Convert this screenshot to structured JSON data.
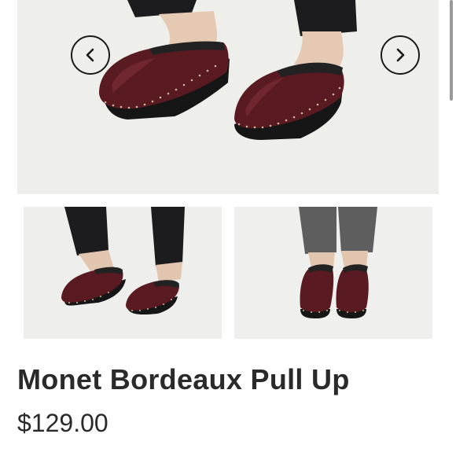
{
  "product": {
    "title": "Monet Bordeaux Pull Up",
    "price": "$129.00"
  },
  "gallery": {
    "prev_icon": "chevron-left-icon",
    "next_icon": "chevron-right-icon",
    "thumbnail_count": 2
  },
  "colors": {
    "text": "#2a2a2a",
    "clog_leather": "#5a1a22",
    "clog_sole": "#1a1a1a",
    "background": "#ffffff"
  }
}
